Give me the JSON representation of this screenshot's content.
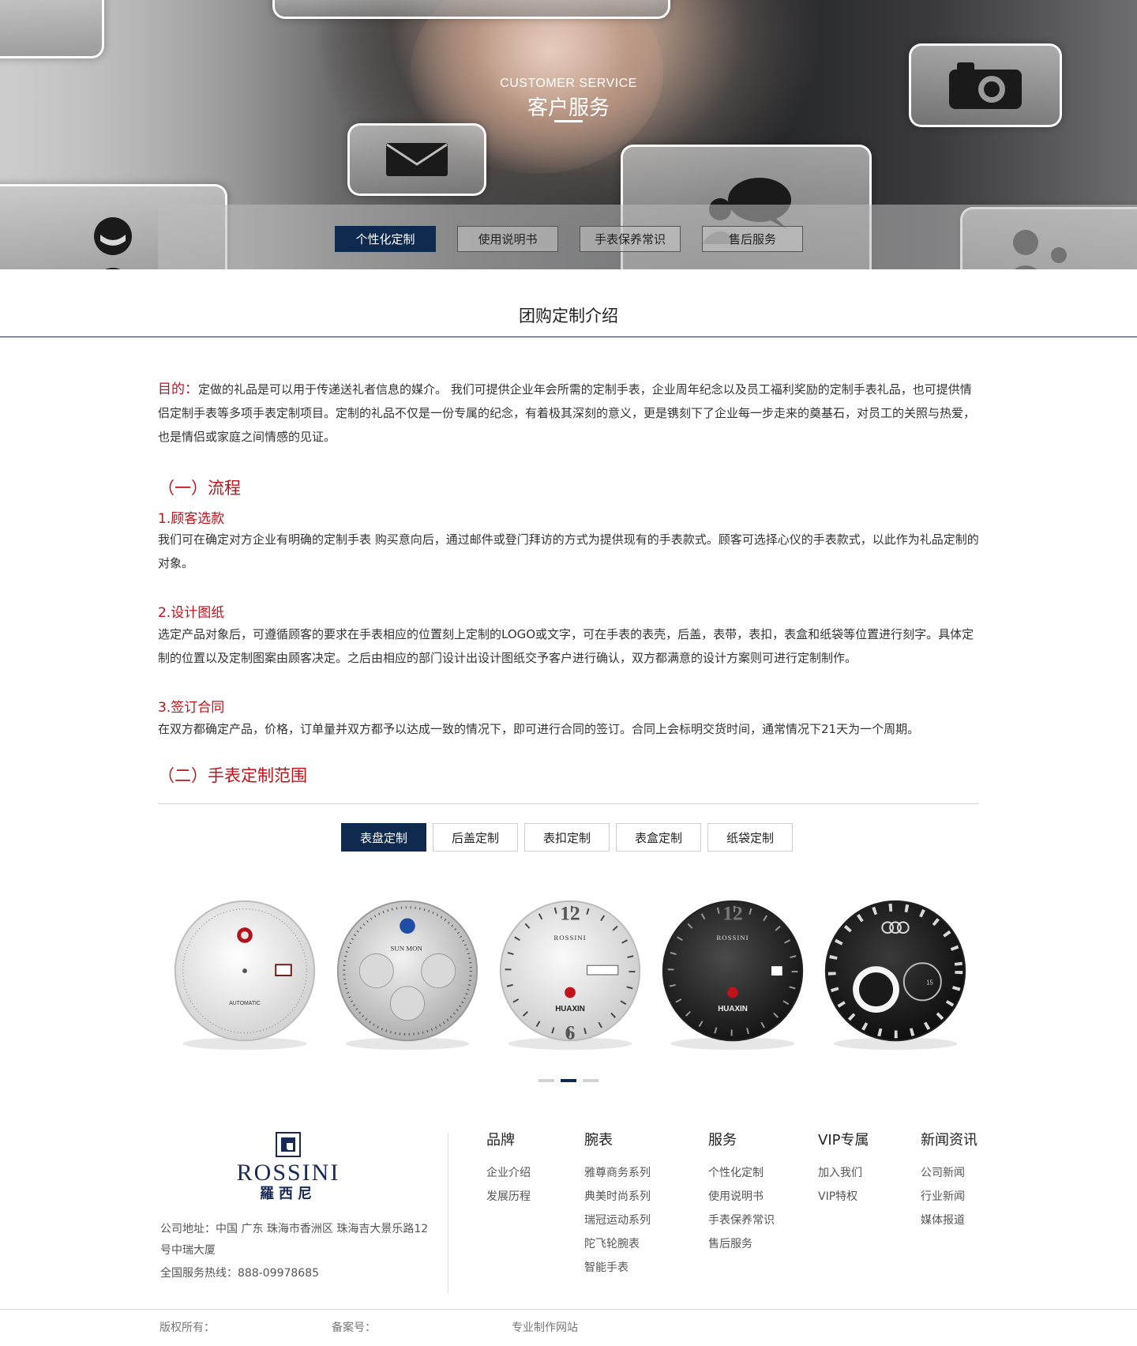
{
  "hero": {
    "title_en": "CUSTOMER SERVICE",
    "title_zh": "客户服务",
    "tabs": [
      {
        "label": "个性化定制",
        "active": true
      },
      {
        "label": "使用说明书",
        "active": false
      },
      {
        "label": "手表保养常识",
        "active": false
      },
      {
        "label": "售后服务",
        "active": false
      }
    ],
    "icons": [
      "mail-icon",
      "camera-icon",
      "chat-icon",
      "person-icon",
      "group-icon"
    ]
  },
  "section": {
    "title": "团购定制介绍",
    "purpose_label": "目的：",
    "purpose_text": "定做的礼品是可以用于传递送礼者信息的媒介。 我们可提供企业年会所需的定制手表，企业周年纪念以及员工福利奖励的定制手表礼品，也可提供情侣定制手表等多项手表定制项目。定制的礼品不仅是一份专属的纪念，有着极其深刻的意义，更是镌刻下了企业每一步走来的奠基石，对员工的关照与热爱，也是情侣或家庭之间情感的见证。",
    "process_heading": "（一）流程",
    "steps": [
      {
        "title": "1.顾客选款",
        "text": "我们可在确定对方企业有明确的定制手表 购买意向后，通过邮件或登门拜访的方式为提供现有的手表款式。顾客可选择心仪的手表款式，以此作为礼品定制的对象。"
      },
      {
        "title": "2.设计图纸",
        "text": "选定产品对象后，可遵循顾客的要求在手表相应的位置刻上定制的LOGO或文字，可在手表的表壳，后盖，表带，表扣，表盒和纸袋等位置进行刻字。具体定制的位置以及定制图案由顾客决定。之后由相应的部门设计出设计图纸交予客户进行确认，双方都满意的设计方案则可进行定制制作。"
      },
      {
        "title": "3.签订合同",
        "text": "在双方都确定产品，价格，订单量并双方都予以达成一致的情况下，即可进行合同的签订。合同上会标明交货时间，通常情况下21天为一个周期。"
      }
    ],
    "scope_heading": "（二）手表定制范围",
    "scope_tabs": [
      {
        "label": "表盘定制",
        "active": true
      },
      {
        "label": "后盖定制",
        "active": false
      },
      {
        "label": "表扣定制",
        "active": false
      },
      {
        "label": "表盒定制",
        "active": false
      },
      {
        "label": "纸袋定制",
        "active": false
      }
    ]
  },
  "dials": [
    {
      "style": "white",
      "label": "AUTOMATIC"
    },
    {
      "style": "silver-chrono",
      "label": "SUN MON"
    },
    {
      "style": "white-brand",
      "brand": "ROSSINI",
      "sub": "HUAXIN"
    },
    {
      "style": "black-brand",
      "brand": "ROSSINI",
      "sub": "HUAXIN"
    },
    {
      "style": "black-roman",
      "label": "15"
    }
  ],
  "carousel": {
    "pages": 3,
    "active": 2
  },
  "footer": {
    "logo_en": "ROSSINI",
    "logo_zh": "羅西尼",
    "address": "公司地址：中国 广东 珠海市香洲区 珠海吉大景乐路12号中瑞大厦",
    "hotline": "全国服务热线：888-09978685",
    "columns": [
      {
        "title": "品牌",
        "links": [
          "企业介绍",
          "发展历程"
        ]
      },
      {
        "title": "腕表",
        "links": [
          "雅尊商务系列",
          "典美时尚系列",
          "瑞冠运动系列",
          "陀飞轮腕表",
          "智能手表"
        ]
      },
      {
        "title": "服务",
        "links": [
          "个性化定制",
          "使用说明书",
          "手表保养常识",
          "售后服务"
        ]
      },
      {
        "title": "VIP专属",
        "links": [
          "加入我们",
          "VIP特权"
        ]
      },
      {
        "title": "新闻资讯",
        "links": [
          "公司新闻",
          "行业新闻",
          "媒体报道"
        ]
      }
    ],
    "copyright": "版权所有：",
    "icp": "备案号：",
    "maker": "专业制作网站"
  },
  "colors": {
    "accent": "#0e2a4e",
    "heading_red": "#c0121b"
  }
}
